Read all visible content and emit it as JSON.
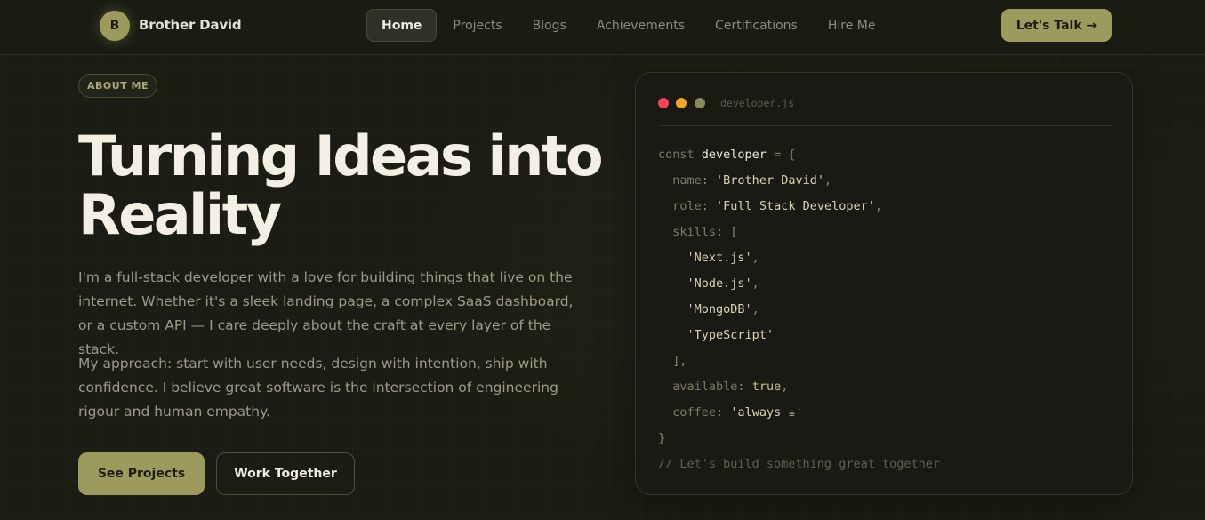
{
  "nav": {
    "logo_initial": "B",
    "logo_name": "Brother David",
    "links": [
      "Home",
      "Projects",
      "Blogs",
      "Achievements",
      "Certifications",
      "Hire Me"
    ],
    "active_link": "Home",
    "cta": "Let's Talk →"
  },
  "hero": {
    "badge": "ABOUT ME",
    "title_line1": "Turning Ideas into",
    "title_line2": "Reality",
    "paragraph1": "I'm a full-stack developer with a love for building things that live on the internet. Whether it's a sleek landing page, a complex SaaS dashboard, or a custom API — I care deeply about the craft at every layer of the stack.",
    "paragraph2": "My approach: start with user needs, design with intention, ship with confidence. I believe great software is the intersection of engineering rigour and human empathy.",
    "primary_button": "See Projects",
    "secondary_button": "Work Together"
  },
  "code_card": {
    "file_name": "developer.js",
    "keyword_const": "const",
    "var_name": "developer",
    "name_key": "name",
    "name_value": "'Brother David'",
    "role_key": "role",
    "role_value": "'Full Stack Developer'",
    "skills_key": "skills",
    "skills": [
      "'Next.js'",
      "'Node.js'",
      "'MongoDB'",
      "'TypeScript'"
    ],
    "available_key": "available",
    "available_value": "true",
    "coffee_key": "coffee",
    "coffee_value": "'always ☕'",
    "comment": "// Let's build something great together"
  },
  "colors": {
    "accent": "#9c9a5c",
    "background": "#1b1d14",
    "dot_red": "#f2435a",
    "dot_yellow": "#f5a623",
    "dot_olive": "#8c8a55"
  }
}
